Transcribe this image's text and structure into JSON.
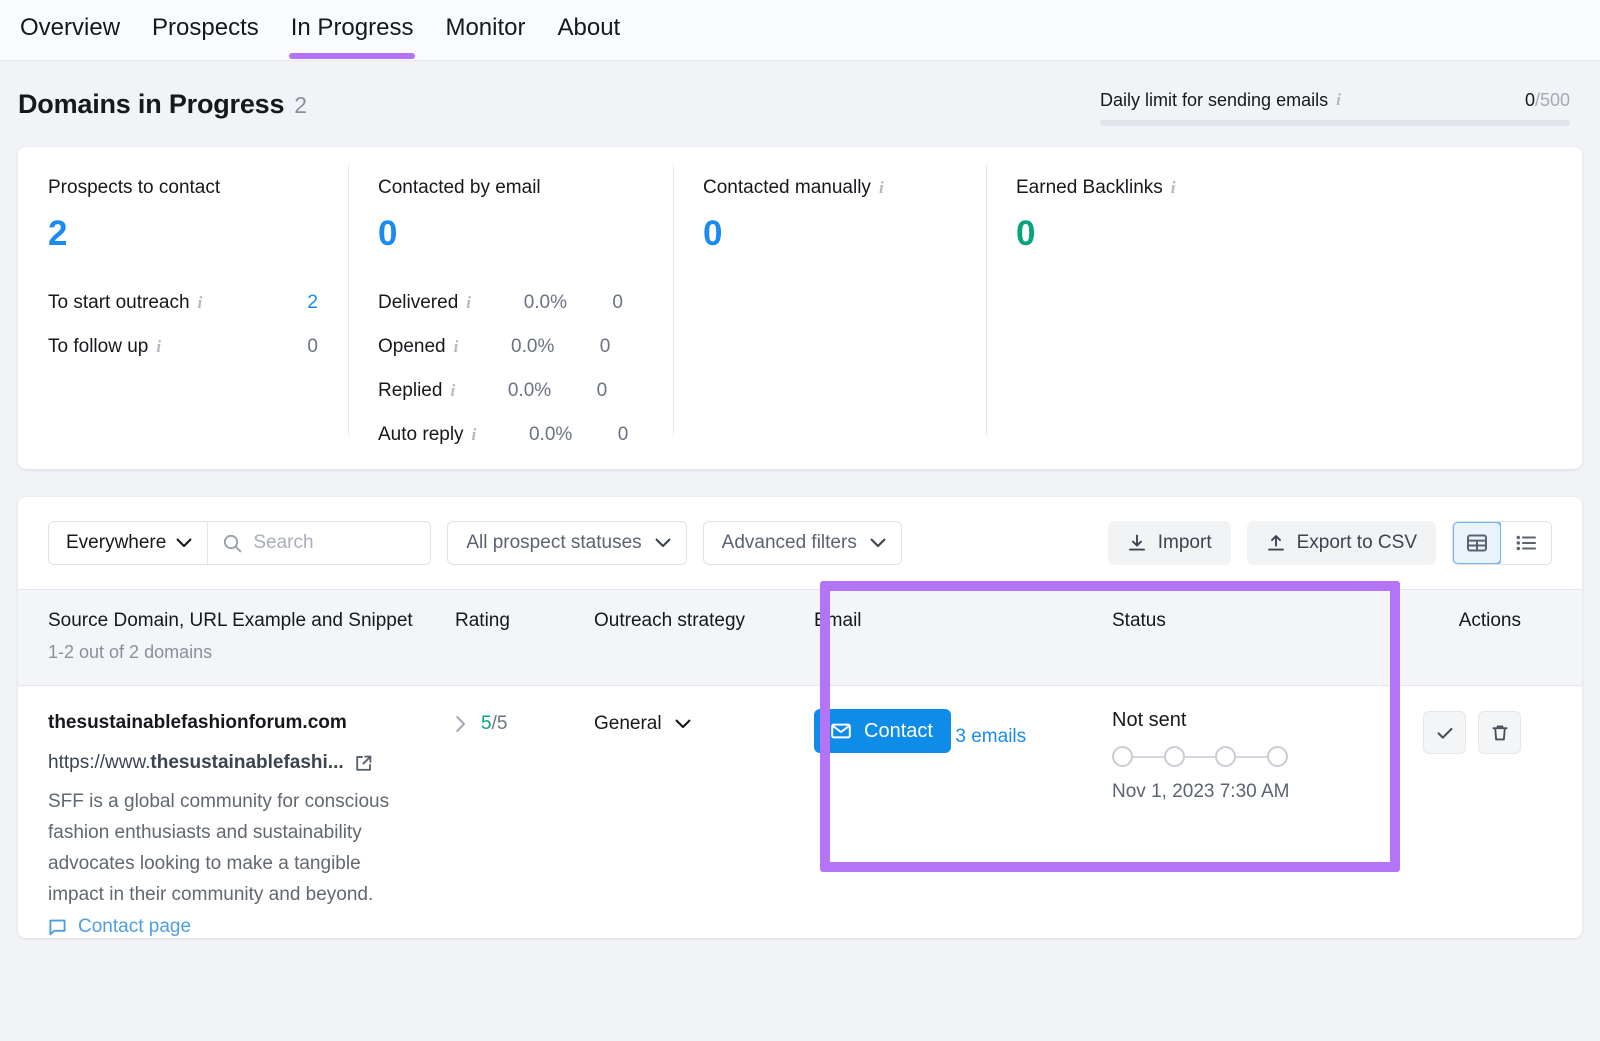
{
  "nav": {
    "tabs": [
      {
        "label": "Overview",
        "active": false
      },
      {
        "label": "Prospects",
        "active": false
      },
      {
        "label": "In Progress",
        "active": true
      },
      {
        "label": "Monitor",
        "active": false
      },
      {
        "label": "About",
        "active": false
      }
    ]
  },
  "header": {
    "title": "Domains in Progress",
    "count": "2",
    "daily_limit_label": "Daily limit for sending emails",
    "daily_limit_used": "0",
    "daily_limit_total": "/500",
    "progress_percent": 0
  },
  "stats": {
    "prospects_to_contact": {
      "label": "Prospects to contact",
      "value": "2",
      "rows": [
        {
          "label": "To start outreach",
          "info": true,
          "value": "2",
          "link": true
        },
        {
          "label": "To follow up",
          "info": true,
          "value": "0",
          "link": false
        }
      ]
    },
    "contacted_by_email": {
      "label": "Contacted by email",
      "value": "0",
      "rows": [
        {
          "label": "Delivered",
          "pct": "0.0%",
          "count": "0"
        },
        {
          "label": "Opened",
          "pct": "0.0%",
          "count": "0"
        },
        {
          "label": "Replied",
          "pct": "0.0%",
          "count": "0"
        },
        {
          "label": "Auto reply",
          "pct": "0.0%",
          "count": "0"
        }
      ]
    },
    "contacted_manually": {
      "label": "Contacted manually",
      "value": "0"
    },
    "earned_backlinks": {
      "label": "Earned Backlinks",
      "value": "0"
    }
  },
  "toolbar": {
    "scope_label": "Everywhere",
    "search_placeholder": "Search",
    "search_value": "",
    "prospect_statuses_label": "All prospect statuses",
    "advanced_filters_label": "Advanced filters",
    "import_label": "Import",
    "export_label": "Export to CSV",
    "view_table_active": true
  },
  "table": {
    "columns": {
      "domain": "Source Domain, URL Example and Snippet",
      "domain_sub": "1-2 out of 2 domains",
      "rating": "Rating",
      "outreach": "Outreach strategy",
      "email": "Email",
      "status": "Status",
      "actions": "Actions"
    },
    "rows": [
      {
        "domain": "thesustainablefashionforum.com",
        "url_prefix": "https://www.",
        "url_bold": "thesustainablefashi...",
        "snippet": "SFF is a global community for conscious fashion enthusiasts and sustainability advocates looking to make a tangible impact in their community and beyond.",
        "contact_page_label": "Contact page",
        "rating_value": "5",
        "rating_denominator": "/5",
        "outreach_strategy": "General",
        "email_button_label": "Contact",
        "emails_link_label": "3 emails",
        "status_text": "Not sent",
        "status_steps": 4,
        "status_completed": 0,
        "status_date": "Nov 1, 2023 7:30 AM"
      }
    ]
  },
  "annotation": {
    "color": "#b374f5",
    "highlights": "email-and-status-columns"
  }
}
